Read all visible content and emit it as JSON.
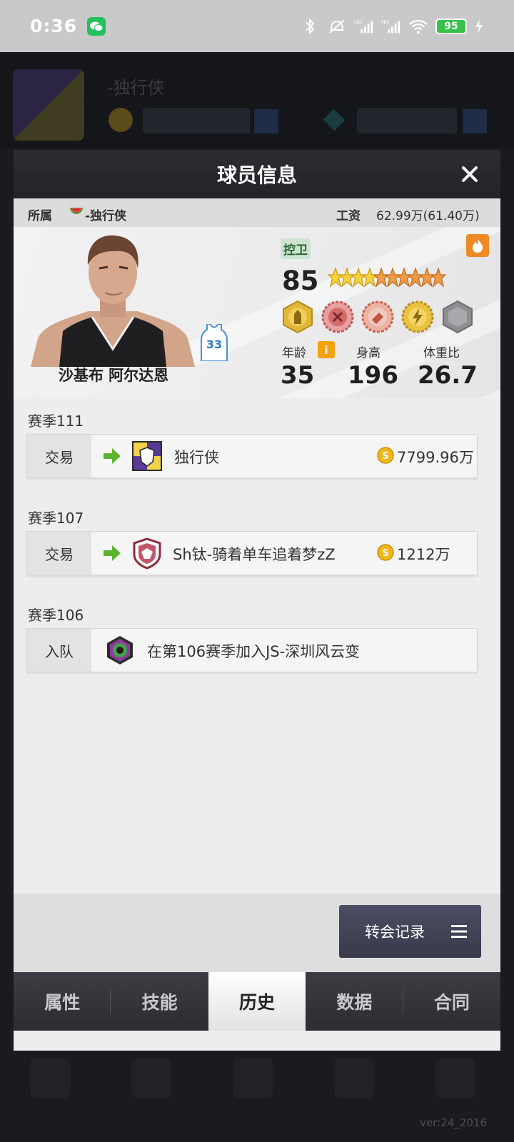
{
  "status_bar": {
    "time": "0:36",
    "battery": "95",
    "icons": [
      "wechat-icon",
      "bluetooth-icon",
      "mute-icon",
      "signal-hd-icon",
      "signal-hd-icon",
      "wifi-icon",
      "battery-icon",
      "charging-icon"
    ]
  },
  "modal": {
    "title": "球员信息",
    "affiliation_label": "所属",
    "affiliation_value": "-独行侠",
    "salary_label": "工资",
    "salary_value": "62.99万(61.40万)"
  },
  "player": {
    "name": "沙基布 阿尔达恩",
    "jersey_number": "33",
    "position": "控卫",
    "overall": "85",
    "stars_total": 10,
    "stars_filled": 4,
    "age_label": "年龄",
    "age": "35",
    "height_label": "身高",
    "height": "196",
    "weight_label": "体重比",
    "weight_ratio": "26.7",
    "info_icon": "i"
  },
  "history": [
    {
      "season": "赛季111",
      "type": "交易",
      "team": "独行侠",
      "fee": "7799.96万",
      "logo": "team-mavericks-logo"
    },
    {
      "season": "赛季107",
      "type": "交易",
      "team": "Sh钛-骑着单车追着梦zZ",
      "fee": "1212万",
      "logo": "team-shield-logo"
    },
    {
      "season": "赛季106",
      "type": "入队",
      "team": "在第106赛季加入JS-深圳风云变",
      "fee": "",
      "logo": "team-hex-logo"
    }
  ],
  "transfer_button": "转会记录",
  "tabs": [
    {
      "label": "属性",
      "active": false
    },
    {
      "label": "技能",
      "active": false
    },
    {
      "label": "历史",
      "active": true
    },
    {
      "label": "数据",
      "active": false
    },
    {
      "label": "合同",
      "active": false
    }
  ],
  "version": "ver:24_2016",
  "colors": {
    "accent_green": "#5bb531",
    "coin_gold": "#f0b719",
    "fire_orange": "#ee8a26"
  }
}
